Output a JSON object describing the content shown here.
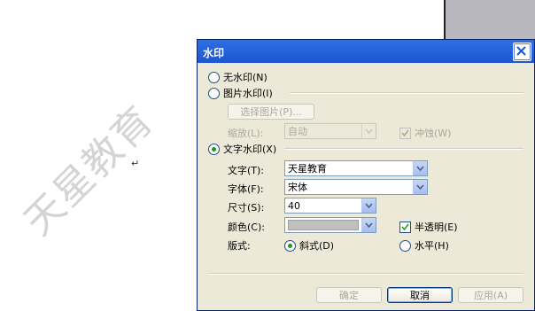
{
  "document": {
    "watermark_preview": "天星教育",
    "return_mark": "↵"
  },
  "dialog": {
    "title": "水印",
    "options": {
      "none": "无水印(N)",
      "picture": "图片水印(I)",
      "select_picture": "选择图片(P)...",
      "scale_label": "缩放(L):",
      "scale_value": "自动",
      "washout": "冲蚀(W)",
      "text": "文字水印(X)"
    },
    "fields": {
      "text_label": "文字(T):",
      "text_value": "天星教育",
      "font_label": "字体(F):",
      "font_value": "宋体",
      "size_label": "尺寸(S):",
      "size_value": "40",
      "color_label": "颜色(C):",
      "semi_transparent": "半透明(E)",
      "layout_label": "版式:",
      "diagonal": "斜式(D)",
      "horizontal": "水平(H)"
    },
    "buttons": {
      "ok": "确定",
      "cancel": "取消",
      "apply": "应用(A)"
    },
    "state": {
      "selected_option": "text",
      "layout": "diagonal",
      "semi_transparent": true,
      "washout": true
    },
    "colors": {
      "titlebar": "#1d56d0",
      "dialog_bg": "#ece9d8",
      "watermark_color": "#c0c0c0"
    }
  }
}
